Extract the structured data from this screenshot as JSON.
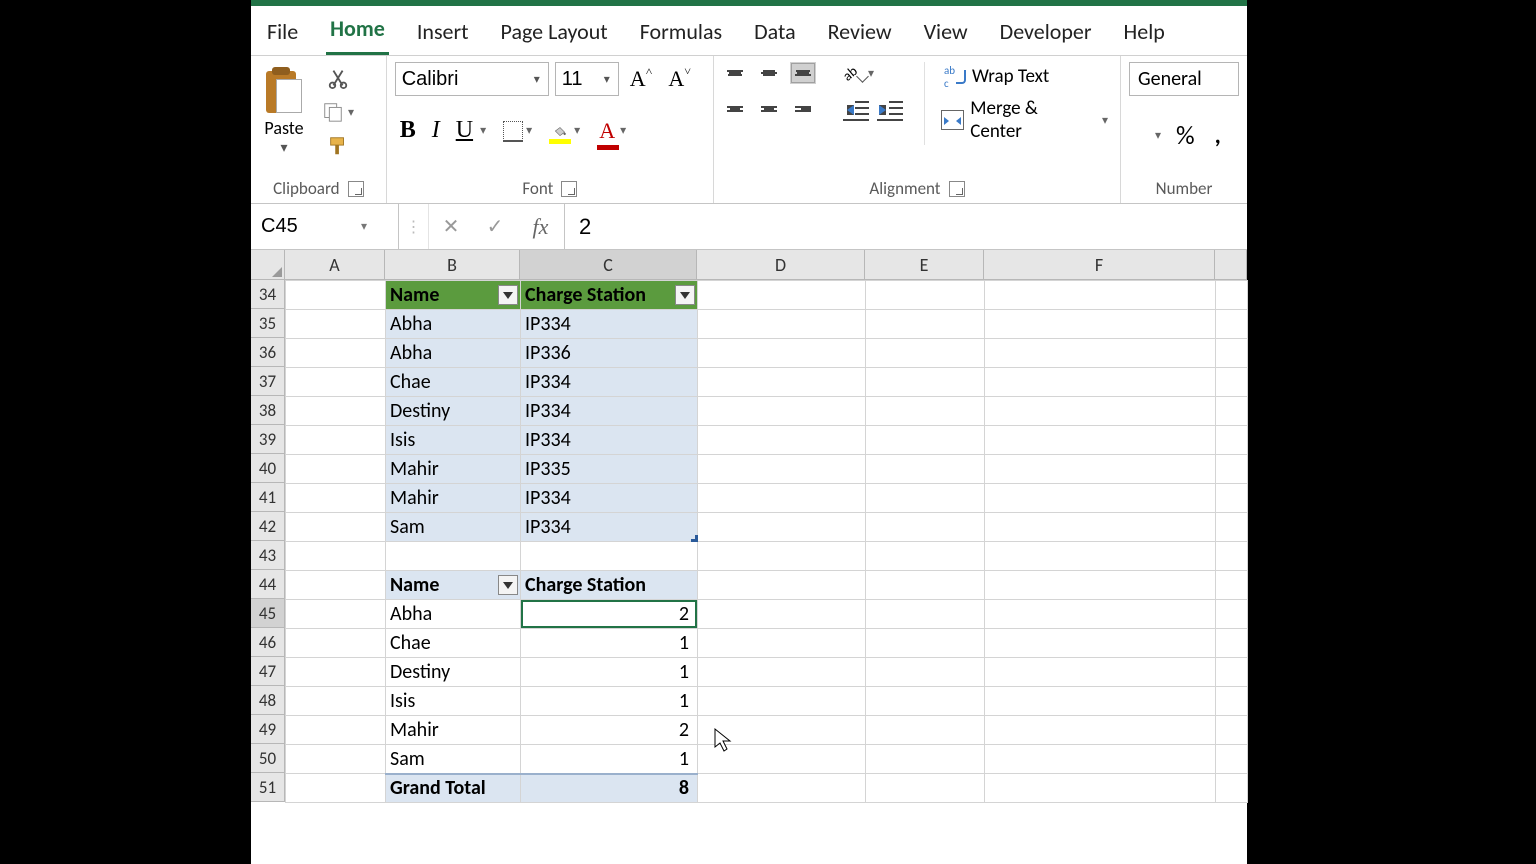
{
  "tabs": {
    "file": "File",
    "home": "Home",
    "insert": "Insert",
    "page_layout": "Page Layout",
    "formulas": "Formulas",
    "data": "Data",
    "review": "Review",
    "view": "View",
    "developer": "Developer",
    "help": "Help"
  },
  "ribbon": {
    "clipboard": {
      "paste": "Paste",
      "label": "Clipboard"
    },
    "font": {
      "name": "Calibri",
      "size": "11",
      "label": "Font",
      "bold": "B",
      "italic": "I",
      "underline": "U",
      "colorA": "A"
    },
    "alignment": {
      "wrap": "Wrap Text",
      "merge": "Merge & Center",
      "label": "Alignment"
    },
    "number": {
      "format": "General",
      "label": "Number",
      "percent": "%"
    }
  },
  "formula_bar": {
    "name_box": "C45",
    "value": "2",
    "fx": "fx",
    "x": "✕",
    "check": "✓"
  },
  "columns": {
    "A": "A",
    "B": "B",
    "C": "C",
    "D": "D",
    "E": "E",
    "F": "F"
  },
  "col_widths": {
    "A": 100,
    "B": 135,
    "C": 177,
    "D": 168,
    "E": 119,
    "F": 231,
    "G": 32
  },
  "rows": [
    "34",
    "35",
    "36",
    "37",
    "38",
    "39",
    "40",
    "41",
    "42",
    "43",
    "44",
    "45",
    "46",
    "47",
    "48",
    "49",
    "50",
    "51"
  ],
  "table1": {
    "header_name": "Name",
    "header_charge": "Charge Station",
    "rows": [
      {
        "name": "Abha",
        "station": "IP334"
      },
      {
        "name": "Abha",
        "station": "IP336"
      },
      {
        "name": "Chae",
        "station": "IP334"
      },
      {
        "name": "Destiny",
        "station": "IP334"
      },
      {
        "name": "Isis",
        "station": "IP334"
      },
      {
        "name": "Mahir",
        "station": "IP335"
      },
      {
        "name": "Mahir",
        "station": "IP334"
      },
      {
        "name": "Sam",
        "station": "IP334"
      }
    ]
  },
  "pivot": {
    "header_name": "Name",
    "header_value": "Charge Station",
    "rows": [
      {
        "name": "Abha",
        "count": "2"
      },
      {
        "name": "Chae",
        "count": "1"
      },
      {
        "name": "Destiny",
        "count": "1"
      },
      {
        "name": "Isis",
        "count": "1"
      },
      {
        "name": "Mahir",
        "count": "2"
      },
      {
        "name": "Sam",
        "count": "1"
      }
    ],
    "grand_label": "Grand Total",
    "grand_value": "8"
  }
}
